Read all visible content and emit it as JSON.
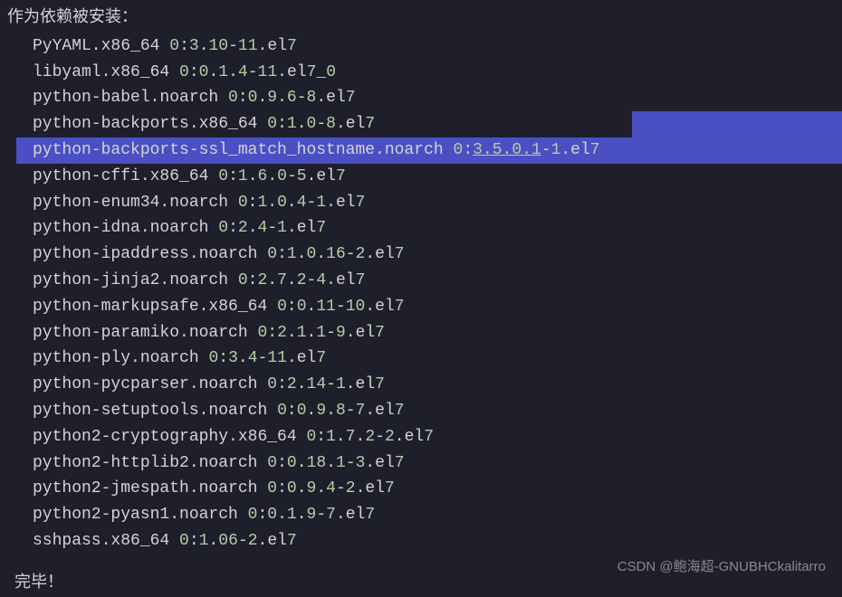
{
  "header": "作为依赖被安装：",
  "packages": [
    {
      "name": "PyYAML",
      "arch": "x86_64",
      "raw": "PyYAML.x86_64 0:3.10-11.el7"
    },
    {
      "name": "libyaml",
      "arch": "x86_64",
      "raw": "libyaml.x86_64 0:0.1.4-11.el7_0"
    },
    {
      "name": "python-babel",
      "arch": "noarch",
      "raw": "python-babel.noarch 0:0.9.6-8.el7"
    },
    {
      "name": "python-backports",
      "arch": "x86_64",
      "raw": "python-backports.x86_64 0:1.0-8.el7",
      "partial_select": true
    },
    {
      "name": "python-backports-ssl_match_hostname",
      "arch": "noarch",
      "raw": "python-backports-ssl_match_hostname.noarch 0:3.5.0.1-1.el7",
      "full_select": true,
      "link": "3.5.0.1"
    },
    {
      "name": "python-cffi",
      "arch": "x86_64",
      "raw": "python-cffi.x86_64 0:1.6.0-5.el7"
    },
    {
      "name": "python-enum34",
      "arch": "noarch",
      "raw": "python-enum34.noarch 0:1.0.4-1.el7"
    },
    {
      "name": "python-idna",
      "arch": "noarch",
      "raw": "python-idna.noarch 0:2.4-1.el7"
    },
    {
      "name": "python-ipaddress",
      "arch": "noarch",
      "raw": "python-ipaddress.noarch 0:1.0.16-2.el7"
    },
    {
      "name": "python-jinja2",
      "arch": "noarch",
      "raw": "python-jinja2.noarch 0:2.7.2-4.el7"
    },
    {
      "name": "python-markupsafe",
      "arch": "x86_64",
      "raw": "python-markupsafe.x86_64 0:0.11-10.el7"
    },
    {
      "name": "python-paramiko",
      "arch": "noarch",
      "raw": "python-paramiko.noarch 0:2.1.1-9.el7"
    },
    {
      "name": "python-ply",
      "arch": "noarch",
      "raw": "python-ply.noarch 0:3.4-11.el7"
    },
    {
      "name": "python-pycparser",
      "arch": "noarch",
      "raw": "python-pycparser.noarch 0:2.14-1.el7"
    },
    {
      "name": "python-setuptools",
      "arch": "noarch",
      "raw": "python-setuptools.noarch 0:0.9.8-7.el7"
    },
    {
      "name": "python2-cryptography",
      "arch": "x86_64",
      "raw": "python2-cryptography.x86_64 0:1.7.2-2.el7"
    },
    {
      "name": "python2-httplib2",
      "arch": "noarch",
      "raw": "python2-httplib2.noarch 0:0.18.1-3.el7"
    },
    {
      "name": "python2-jmespath",
      "arch": "noarch",
      "raw": "python2-jmespath.noarch 0:0.9.4-2.el7"
    },
    {
      "name": "python2-pyasn1",
      "arch": "noarch",
      "raw": "python2-pyasn1.noarch 0:0.1.9-7.el7"
    },
    {
      "name": "sshpass",
      "arch": "x86_64",
      "raw": "sshpass.x86_64 0:1.06-2.el7"
    }
  ],
  "footer": "完毕！",
  "watermark": "CSDN @鲍海超-GNUBHCkalitarro",
  "colors": {
    "bg": "#1e1f2b",
    "text": "#d4d4d4",
    "number": "#b5cea8",
    "selection": "#4b4fc4"
  }
}
